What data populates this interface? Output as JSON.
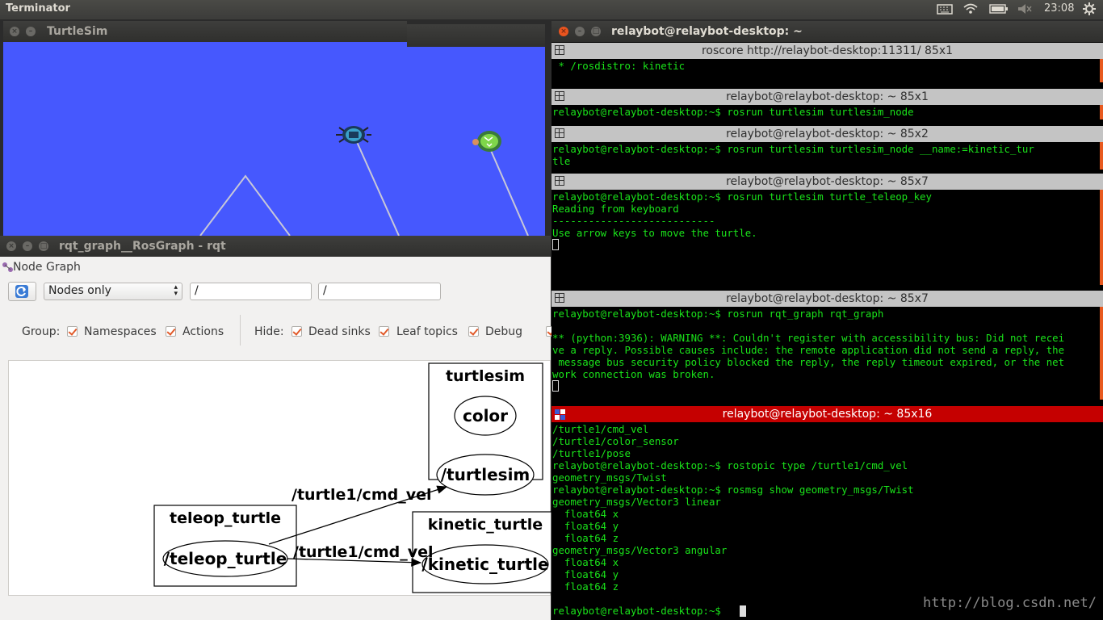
{
  "top_panel": {
    "app_name": "Terminator",
    "time": "23:08"
  },
  "turtlesim": {
    "title": "TurtleSim"
  },
  "rqt": {
    "title": "rqt_graph__RosGraph - rqt",
    "plugin_title": "Node Graph",
    "mode_select": "Nodes only",
    "filter1": "/",
    "filter2": "/",
    "group_label": "Group:",
    "namespaces_label": "Namespaces",
    "actions_label": "Actions",
    "hide_label": "Hide:",
    "dead_sinks_label": "Dead sinks",
    "leaf_topics_label": "Leaf topics",
    "debug_label": "Debug",
    "graph": {
      "turtlesim_ns": "turtlesim",
      "color_node": "color",
      "turtlesim_node": "/turtlesim",
      "teleop_ns": "teleop_turtle",
      "teleop_node": "/teleop_turtle",
      "kinetic_ns": "kinetic_turtle",
      "kinetic_node": "/kinetic_turtle",
      "edge1": "/turtle1/cmd_vel",
      "edge2": "/turtle1/cmd_vel"
    }
  },
  "terminator": {
    "title": "relaybot@relaybot-desktop: ~",
    "panes": [
      {
        "title": "roscore http://relaybot-desktop:11311/ 85x1",
        "lines": [
          " * /rosdistro: kinetic"
        ]
      },
      {
        "title": "relaybot@relaybot-desktop: ~ 85x1",
        "lines": [
          "relaybot@relaybot-desktop:~$ rosrun turtlesim turtlesim_node"
        ]
      },
      {
        "title": "relaybot@relaybot-desktop: ~ 85x2",
        "lines": [
          "relaybot@relaybot-desktop:~$ rosrun turtlesim turtlesim_node __name:=kinetic_tur",
          "tle"
        ]
      },
      {
        "title": "relaybot@relaybot-desktop: ~ 85x7",
        "lines": [
          "relaybot@relaybot-desktop:~$ rosrun turtlesim turtle_teleop_key",
          "Reading from keyboard",
          "---------------------------",
          "Use arrow keys to move the turtle."
        ]
      },
      {
        "title": "relaybot@relaybot-desktop: ~ 85x7",
        "lines": [
          "relaybot@relaybot-desktop:~$ rosrun rqt_graph rqt_graph",
          "",
          "** (python:3936): WARNING **: Couldn't register with accessibility bus: Did not recei",
          "ve a reply. Possible causes include: the remote application did not send a reply, the",
          " message bus security policy blocked the reply, the reply timeout expired, or the net",
          "work connection was broken."
        ]
      },
      {
        "title": "relaybot@relaybot-desktop: ~ 85x16",
        "lines": [
          "/turtle1/cmd_vel",
          "/turtle1/color_sensor",
          "/turtle1/pose",
          "relaybot@relaybot-desktop:~$ rostopic type /turtle1/cmd_vel",
          "geometry_msgs/Twist",
          "relaybot@relaybot-desktop:~$ rosmsg show geometry_msgs/Twist",
          "geometry_msgs/Vector3 linear",
          "  float64 x",
          "  float64 y",
          "  float64 z",
          "geometry_msgs/Vector3 angular",
          "  float64 x",
          "  float64 y",
          "  float64 z",
          "",
          "relaybot@relaybot-desktop:~$ "
        ]
      }
    ]
  },
  "watermark": "http://blog.csdn.net/"
}
